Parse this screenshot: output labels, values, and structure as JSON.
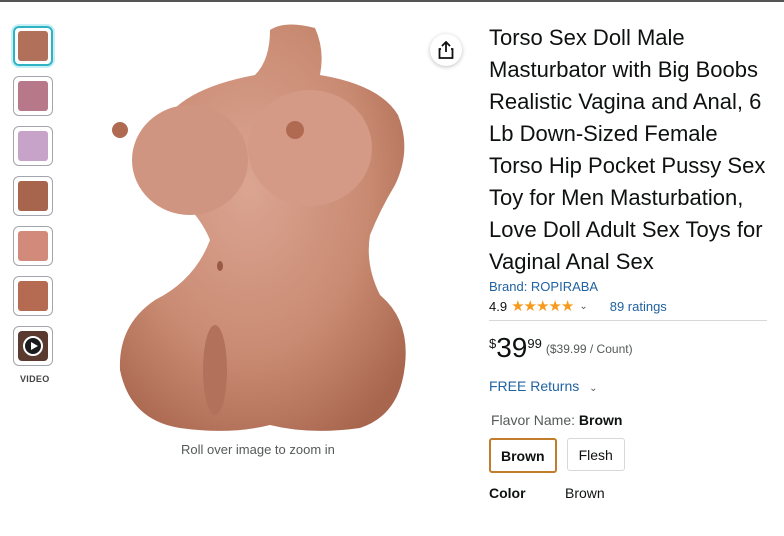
{
  "thumbnails": [
    {
      "name": "thumb-1",
      "color": "#b0705a"
    },
    {
      "name": "thumb-2",
      "color": "#b7798a"
    },
    {
      "name": "thumb-3",
      "color": "#c7a3c9"
    },
    {
      "name": "thumb-4",
      "color": "#a7654d"
    },
    {
      "name": "thumb-5",
      "color": "#d28a7a"
    },
    {
      "name": "thumb-6",
      "color": "#b46b52"
    }
  ],
  "video_label": "VIDEO",
  "zoom_hint": "Roll over image to zoom in",
  "product": {
    "title": "Torso Sex Doll Male Masturbator with Big Boobs Realistic Vagina and Anal, 6 Lb Down-Sized Female Torso Hip Pocket Pussy Sex Toy for Men Masturbation, Love Doll Adult Sex Toys for Vaginal Anal Sex",
    "brand": "Brand: ROPIRABA",
    "rating": "4.9",
    "stars": "★★★★★",
    "ratings_count": "89 ratings",
    "price_symbol": "$",
    "price_whole": "39",
    "price_fraction": "99",
    "price_per_unit": "($39.99 / Count)",
    "returns": "FREE Returns",
    "flavor_label": "Flavor Name:",
    "flavor_value": "Brown",
    "options": [
      "Brown",
      "Flesh"
    ],
    "color_label": "Color",
    "color_value": "Brown"
  },
  "colors": {
    "accent_link": "#2162a1",
    "star": "#f79a1b",
    "selected_border": "#c17d2b"
  }
}
